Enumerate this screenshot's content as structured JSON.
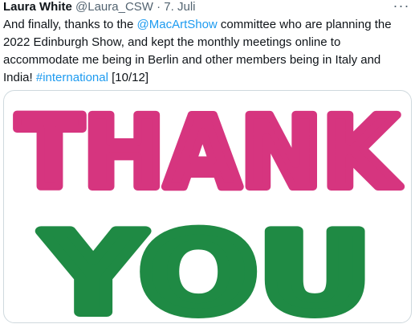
{
  "tweet": {
    "author_name": "Laura White",
    "author_handle": "@Laura_CSW",
    "separator": "·",
    "date": "7. Juli",
    "more_glyph": "···",
    "text_parts": {
      "p1": "And finally, thanks to the ",
      "mention": "@MacArtShow",
      "p2": " committee who are planning the 2022 Edinburgh Show, and kept the monthly meetings online to accommodate me being in Berlin and other members being in Italy and India! ",
      "hashtag": "#international",
      "p3": " [10/12]"
    }
  },
  "image": {
    "line1": "THANK",
    "line2": "YOU",
    "line1_color": "#d6357f",
    "line2_color": "#1f8a44"
  }
}
